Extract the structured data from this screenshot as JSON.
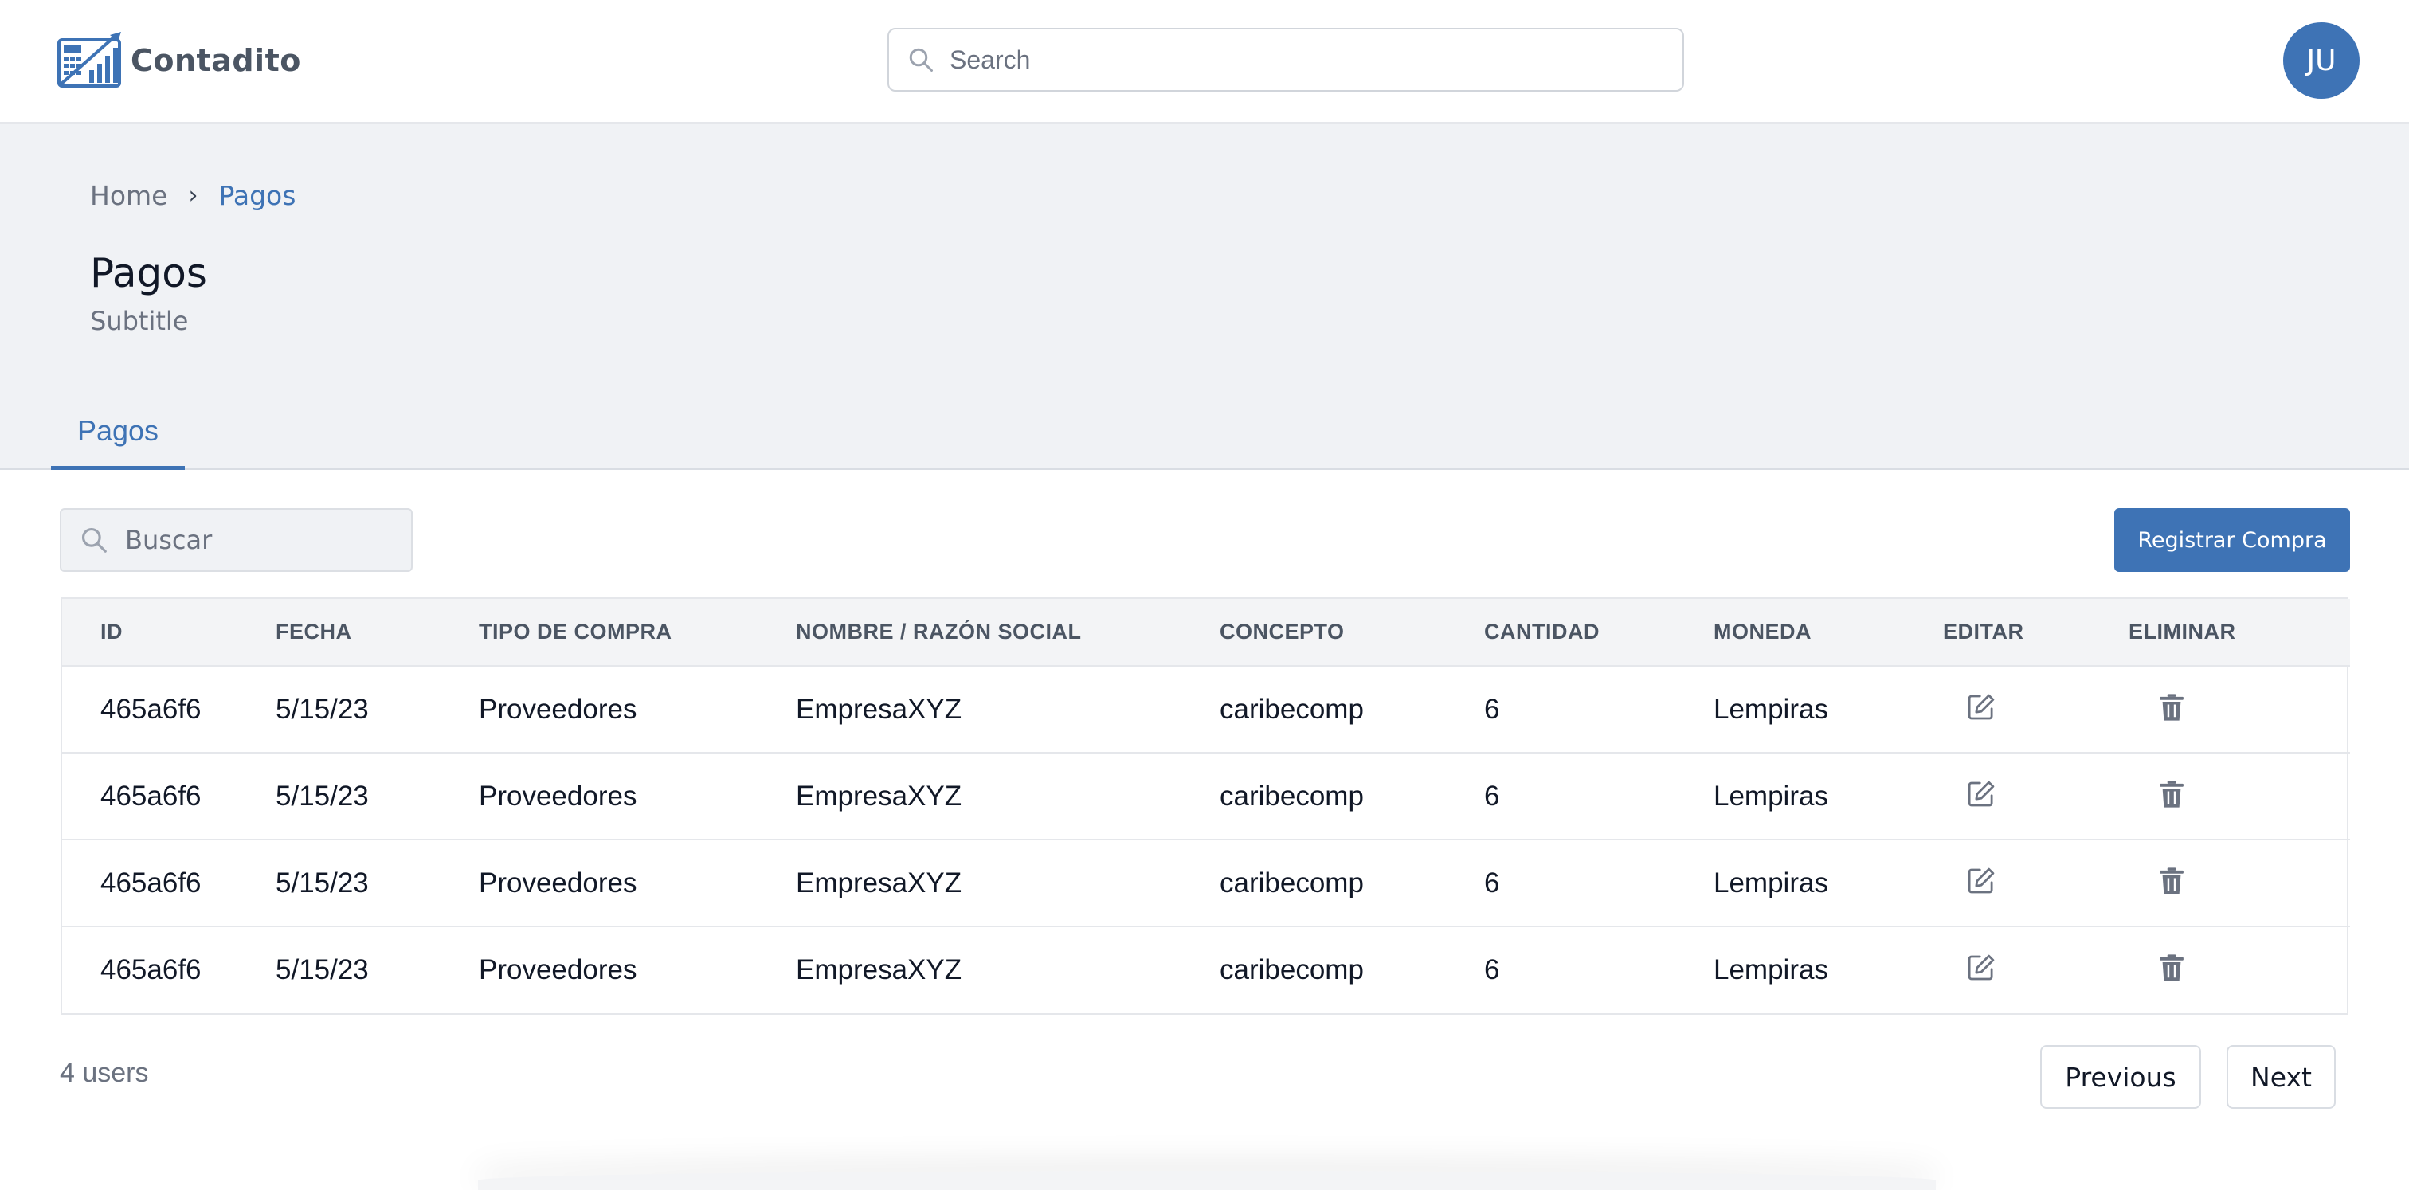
{
  "app": {
    "name": "Contadito",
    "search_placeholder": "Search",
    "avatar_initials": "JU",
    "accent_color": "#3e73b5"
  },
  "breadcrumb": {
    "home": "Home",
    "separator": "›",
    "current": "Pagos"
  },
  "page": {
    "title": "Pagos",
    "subtitle": "Subtitle"
  },
  "tabs": [
    {
      "label": "Pagos",
      "active": true
    }
  ],
  "toolbar": {
    "search_placeholder": "Buscar",
    "primary_button": "Registrar Compra"
  },
  "table": {
    "columns": [
      "ID",
      "FECHA",
      "TIPO DE COMPRA",
      "NOMBRE / RAZÓN SOCIAL",
      "CONCEPTO",
      "CANTIDAD",
      "MONEDA",
      "EDITAR",
      "ELIMINAR"
    ],
    "rows": [
      {
        "id": "465a6f6",
        "fecha": "5/15/23",
        "tipo": "Proveedores",
        "nombre": "EmpresaXYZ",
        "concepto": "caribecomp",
        "cantidad": "6",
        "moneda": "Lempiras",
        "edit_icon": "edit-icon",
        "delete_icon": "trash-icon"
      },
      {
        "id": "465a6f6",
        "fecha": "5/15/23",
        "tipo": "Proveedores",
        "nombre": "EmpresaXYZ",
        "concepto": "caribecomp",
        "cantidad": "6",
        "moneda": "Lempiras",
        "edit_icon": "edit-icon",
        "delete_icon": "trash-icon"
      },
      {
        "id": "465a6f6",
        "fecha": "5/15/23",
        "tipo": "Proveedores",
        "nombre": "EmpresaXYZ",
        "concepto": "caribecomp",
        "cantidad": "6",
        "moneda": "Lempiras",
        "edit_icon": "edit-icon",
        "delete_icon": "trash-icon"
      },
      {
        "id": "465a6f6",
        "fecha": "5/15/23",
        "tipo": "Proveedores",
        "nombre": "EmpresaXYZ",
        "concepto": "caribecomp",
        "cantidad": "6",
        "moneda": "Lempiras",
        "edit_icon": "edit-icon",
        "delete_icon": "trash-icon"
      }
    ]
  },
  "footer": {
    "count_label": "4 users",
    "previous": "Previous",
    "next": "Next"
  }
}
